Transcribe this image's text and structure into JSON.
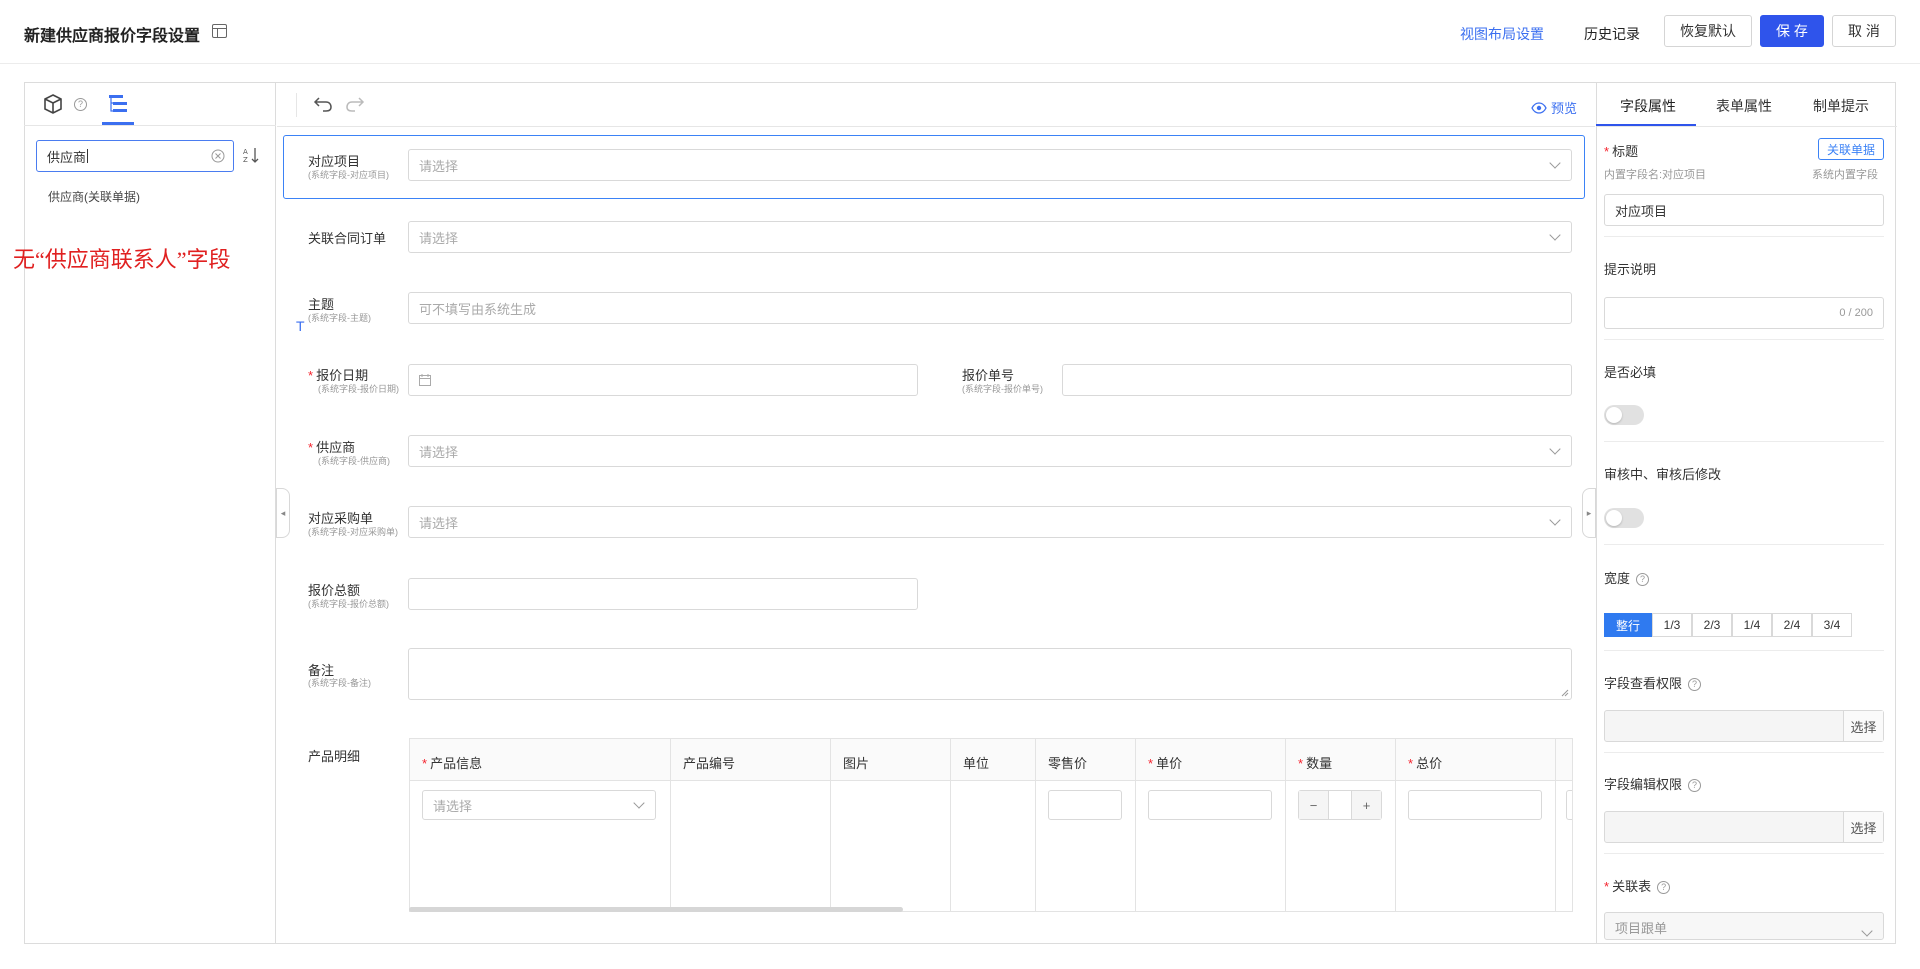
{
  "header": {
    "title": "新建供应商报价字段设置",
    "view_layout": "视图布局设置",
    "history": "历史记录",
    "restore": "恢复默认",
    "save": "保 存",
    "cancel": "取 消"
  },
  "left": {
    "search_value": "供应商",
    "result": "供应商(关联单据)",
    "annotation": "无“供应商联系人”字段"
  },
  "canvas": {
    "preview": "预览",
    "text_tool": "T",
    "rows": [
      {
        "label": "对应项目",
        "sub": "(系统字段-对应项目)",
        "placeholder": "请选择"
      },
      {
        "label": "关联合同订单",
        "sub": "",
        "placeholder": "请选择"
      },
      {
        "label": "主题",
        "sub": "(系统字段-主题)",
        "placeholder": "可不填写由系统生成"
      },
      {
        "label": "报价日期",
        "sub": "(系统字段-报价日期)",
        "placeholder": ""
      },
      {
        "label": "报价单号",
        "sub": "(系统字段-报价单号)",
        "placeholder": ""
      },
      {
        "label": "供应商",
        "sub": "(系统字段-供应商)",
        "placeholder": "请选择"
      },
      {
        "label": "对应采购单",
        "sub": "(系统字段-对应采购单)",
        "placeholder": "请选择"
      },
      {
        "label": "报价总额",
        "sub": "(系统字段-报价总额)",
        "placeholder": ""
      },
      {
        "label": "备注",
        "sub": "(系统字段-备注)",
        "placeholder": ""
      }
    ],
    "product": {
      "label": "产品明细",
      "columns": [
        "产品信息",
        "产品编号",
        "图片",
        "单位",
        "零售价",
        "单价",
        "数量",
        "总价"
      ],
      "select_placeholder": "请选择",
      "qty_minus": "−",
      "qty_plus": "+"
    }
  },
  "right": {
    "tabs": [
      "字段属性",
      "表单属性",
      "制单提示"
    ],
    "title_label": "标题",
    "related_btn": "关联单据",
    "builtin_name": "内置字段名:对应项目",
    "system_builtin": "系统内置字段",
    "title_value": "对应项目",
    "hint_label": "提示说明",
    "hint_counter": "0 / 200",
    "required_label": "是否必填",
    "audit_label": "审核中、审核后修改",
    "width_label": "宽度",
    "width_options": [
      "整行",
      "1/3",
      "2/3",
      "1/4",
      "2/4",
      "3/4"
    ],
    "view_perm_label": "字段查看权限",
    "edit_perm_label": "字段编辑权限",
    "pick": "选择",
    "related_table_label": "关联表",
    "related_table_value": "项目跟单",
    "help": "?"
  },
  "colors": {
    "primary": "#2f54eb",
    "link": "#3b6ff0",
    "required": "#f5222d",
    "annotation": "#e02020"
  }
}
